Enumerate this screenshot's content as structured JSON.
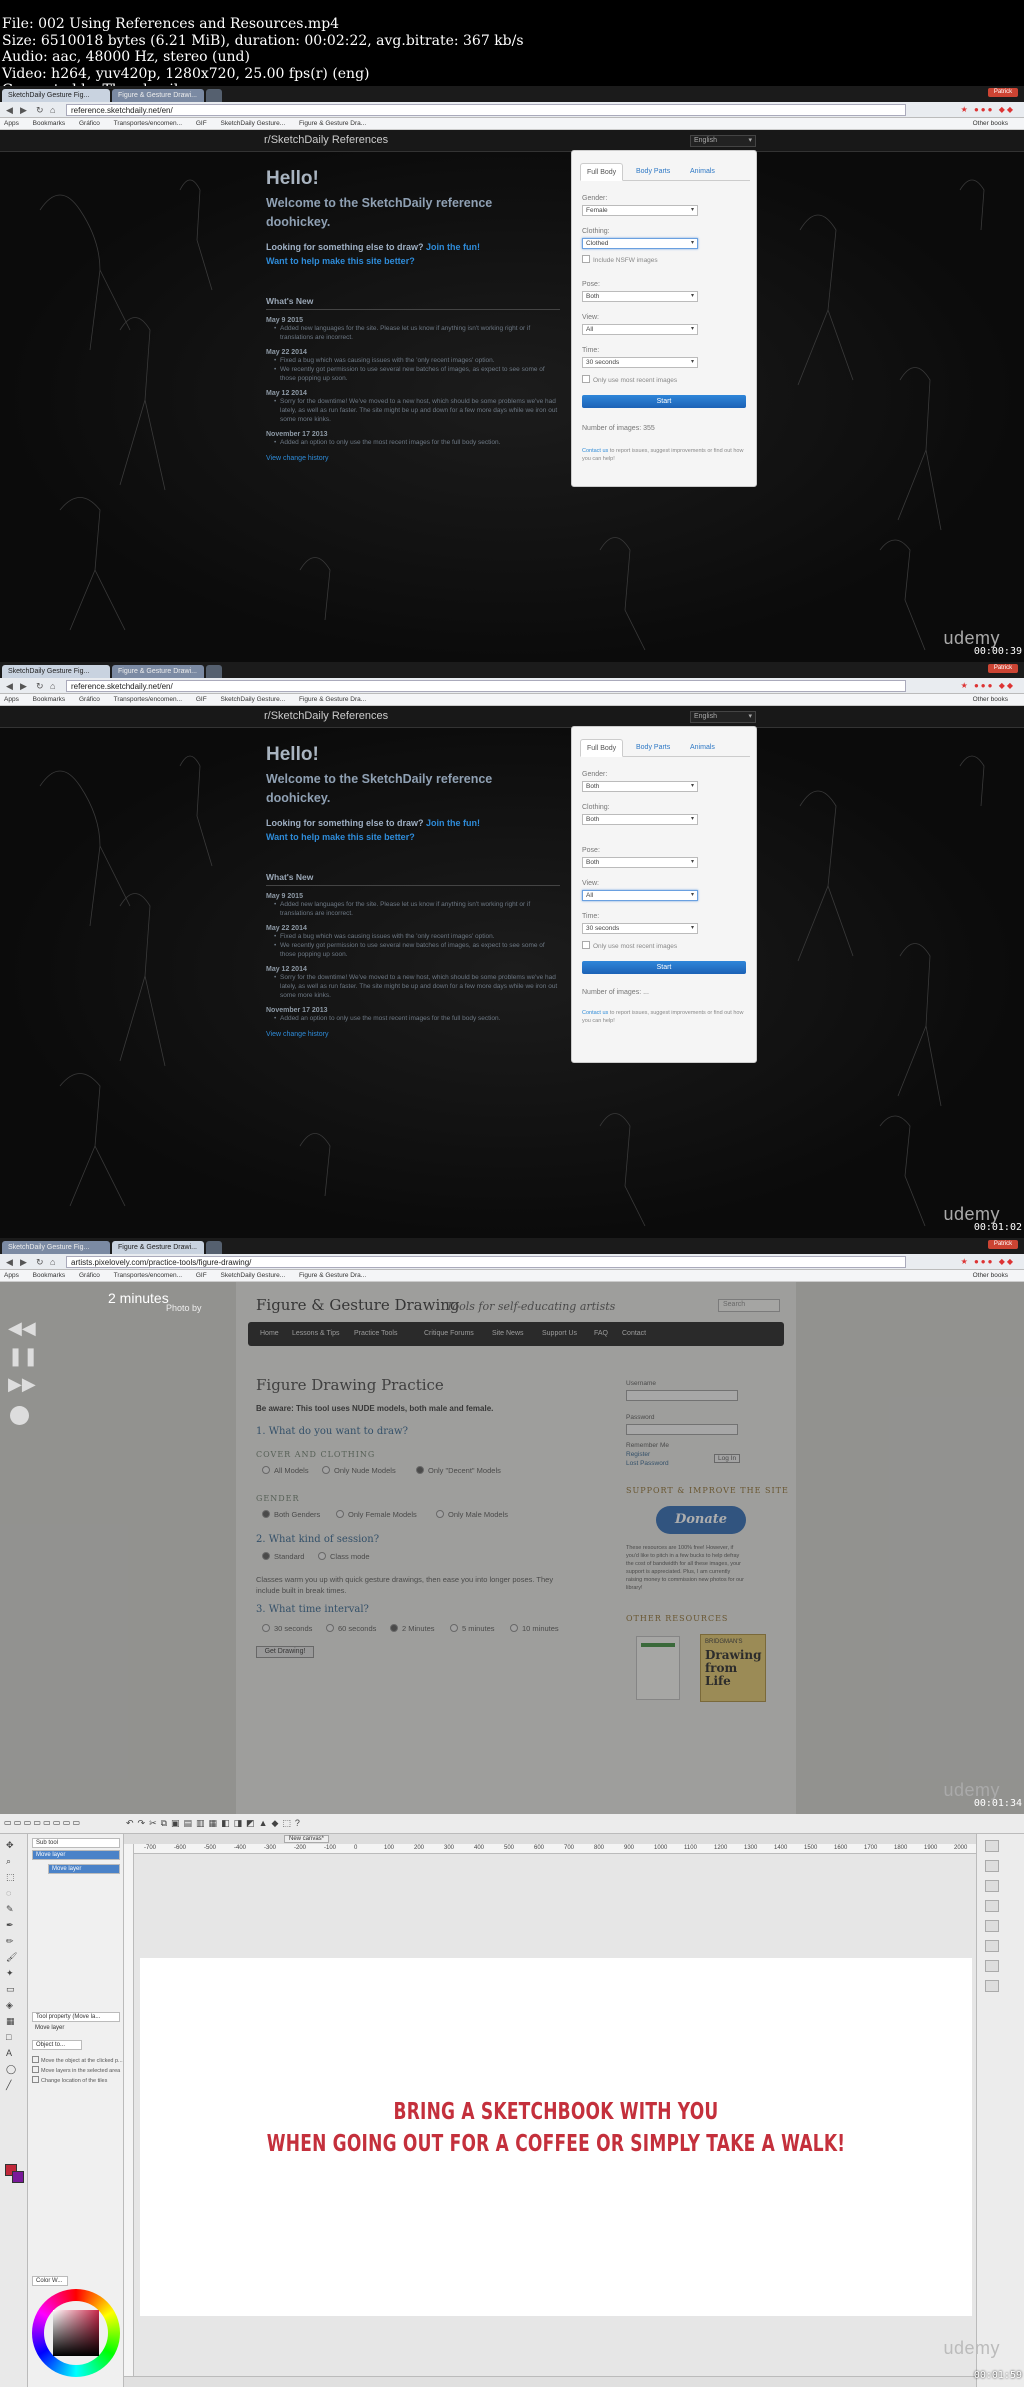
{
  "meta": {
    "lines": [
      "File: 002 Using References and Resources.mp4",
      "Size: 6510018 bytes (6.21 MiB), duration: 00:02:22, avg.bitrate: 367 kb/s",
      "Audio: aac, 48000 Hz, stereo (und)",
      "Video: h264, yuv420p, 1280x720, 25.00 fps(r) (eng)",
      "Generated by Thumbnail me"
    ]
  },
  "browser": {
    "tabs_sd": [
      "SketchDaily Gesture Fig...",
      "Figure & Gesture Drawi..."
    ],
    "tabs_pl": [
      "SketchDaily Gesture Fig...",
      "Figure & Gesture Drawi..."
    ],
    "url_sd": "reference.sketchdaily.net/en/",
    "url_pl": "artists.pixelovely.com/practice-tools/figure-drawing/",
    "bookmarks": [
      "Apps",
      "Bookmarks",
      "Gráfico",
      "Transportes/encomen...",
      "GIF",
      "SketchDaily Gesture...",
      "Figure & Gesture Dra..."
    ],
    "other_bookmarks": "Other books",
    "winctl": "Patrick"
  },
  "sketchdaily": {
    "brand": "r/SketchDaily References",
    "language": "English",
    "hello": "Hello!",
    "welcome": "Welcome to the SketchDaily reference doohickey.",
    "looking": "Looking for something else to draw?",
    "join": "Join the fun!",
    "help": "Want to help make this site better?",
    "whats_new": "What's New",
    "news": [
      {
        "date": "May 9 2015",
        "items": [
          "Added new languages for the site. Please let us know if anything isn't working right or if translations are incorrect."
        ]
      },
      {
        "date": "May 22 2014",
        "items": [
          "Fixed a bug which was causing issues with the 'only recent images' option.",
          "We recently got permission to use several new batches of images, as expect to see some of those popping up soon."
        ]
      },
      {
        "date": "May 12 2014",
        "items": [
          "Sorry for the downtime! We've moved to a new host, which should be some problems we've had lately, as well as run faster. The site might be up and down for a few more days while we iron out some more kinks."
        ]
      },
      {
        "date": "November 17 2013",
        "items": [
          "Added an option to only use the most recent images for the full body section."
        ]
      }
    ],
    "view_history": "View change history",
    "panel": {
      "tabs": [
        "Full Body",
        "Body Parts",
        "Animals"
      ],
      "gender_label": "Gender:",
      "clothing_label": "Clothing:",
      "nsfw_label": "Include NSFW images",
      "pose_label": "Pose:",
      "view_label": "View:",
      "time_label": "Time:",
      "recent_label": "Only use most recent images",
      "start": "Start",
      "number_label": "Number of images:",
      "contact_link": "Contact us",
      "contact_rest": " to report issues, suggest improvements or find out how you can help!"
    },
    "frame1": {
      "gender": "Female",
      "clothing": "Clothed",
      "pose": "Both",
      "view": "All",
      "time": "30 seconds",
      "count": "355"
    },
    "frame2": {
      "gender": "Both",
      "clothing": "Both",
      "pose": "Both",
      "view": "All",
      "time": "30 seconds",
      "count": "..."
    }
  },
  "stamps": {
    "f1": "00:00:39",
    "f2": "00:01:02",
    "f3": "00:01:34",
    "f4": "00:01:59",
    "brand": "udemy"
  },
  "pixelovely": {
    "timer": "2 minutes",
    "photo": "Photo by",
    "title": "Figure & Gesture Drawing",
    "tagline": "Tools for self-educating artists",
    "search": "Search",
    "menu": [
      "Home",
      "Lessons & Tips",
      "Practice Tools",
      "Critique Forums",
      "Site News",
      "Support Us",
      "FAQ",
      "Contact"
    ],
    "heading": "Figure Drawing Practice",
    "aware": "Be aware: This tool uses NUDE models, both male and female.",
    "q1": "1. What do you want to draw?",
    "cover": "COVER AND CLOTHING",
    "cover_opts": [
      "All Models",
      "Only Nude Models",
      "Only \"Decent\" Models"
    ],
    "gender": "GENDER",
    "gender_opts": [
      "Both Genders",
      "Only Female Models",
      "Only Male Models"
    ],
    "q2": "2. What kind of session?",
    "session_opts": [
      "Standard",
      "Class mode"
    ],
    "para": "Classes warm you up with quick gesture drawings, then ease you into longer poses. They include built in break times.",
    "q3": "3. What time interval?",
    "time_opts": [
      "30 seconds",
      "60 seconds",
      "2 Minutes",
      "5 minutes",
      "10 minutes"
    ],
    "go": "Get Drawing!",
    "username": "Username",
    "password": "Password",
    "remember": "Remember Me",
    "register": "Register",
    "lost": "Lost Password",
    "login": "Log In",
    "support": "SUPPORT & IMPROVE THE SITE",
    "donate": "Donate",
    "donate_text": "These resources are 100% free! However, if you'd like to pitch in a few bucks to help defray the cost of bandwidth for all these images, your support is appreciated. Plus, I am currently raising money to commission new photos for our library!",
    "other": "OTHER RESOURCES",
    "book_author": "BRIDGMAN'S",
    "book_title": "Drawing from Life"
  },
  "paint": {
    "tabs": [
      "New canvas*"
    ],
    "panel_items": [
      "Sub tool",
      "Move layer",
      "Move layer",
      "Tool property (Move la...",
      "Move layer",
      "Object to...",
      "Move the object at the clicked p...",
      "Move layers in the selected area",
      "Change location of the tiles"
    ],
    "ruler": [
      "-700",
      "-600",
      "-500",
      "-400",
      "-300",
      "-200",
      "-100",
      "0",
      "100",
      "200",
      "300",
      "400",
      "500",
      "600",
      "700",
      "800",
      "900",
      "1000",
      "1100",
      "1200",
      "1300",
      "1400",
      "1500",
      "1600",
      "1700",
      "1800",
      "1900",
      "2000"
    ],
    "canvas_line1": "BRING A SKETCHBOOK WITH YOU",
    "canvas_line2": "WHEN GOING OUT FOR A COFFEE OR SIMPLY TAKE A WALK!",
    "color_label": "Color W..."
  },
  "colors": {
    "accent_blue": "#2e8bd8",
    "canvas_text": "#c4303c",
    "start_button": "#1c62b6"
  }
}
